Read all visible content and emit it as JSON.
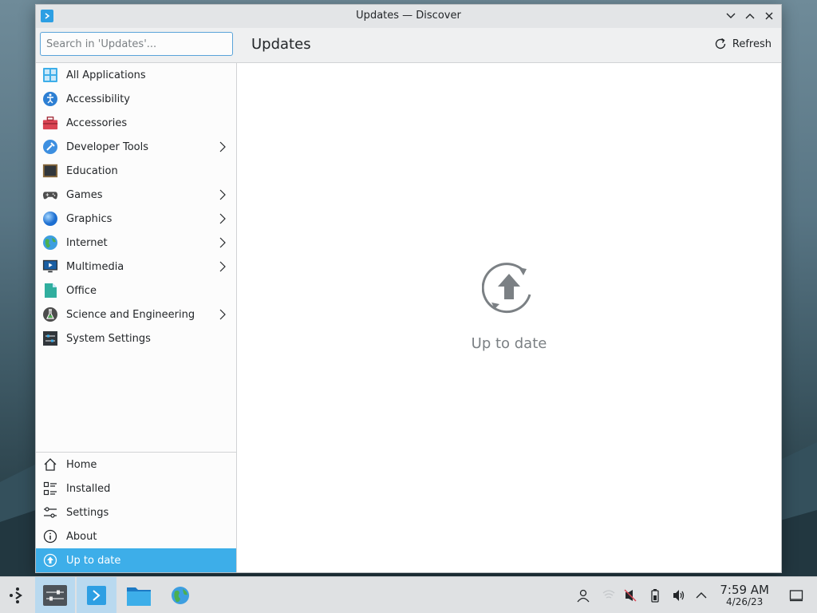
{
  "window": {
    "title": "Updates — Discover"
  },
  "search": {
    "placeholder": "Search in 'Updates'..."
  },
  "header": {
    "page_title": "Updates",
    "refresh_label": "Refresh"
  },
  "categories": [
    {
      "label": "All Applications",
      "icon": "grid-icon",
      "has_submenu": false
    },
    {
      "label": "Accessibility",
      "icon": "accessibility-icon",
      "has_submenu": false
    },
    {
      "label": "Accessories",
      "icon": "toolbox-icon",
      "has_submenu": false
    },
    {
      "label": "Developer Tools",
      "icon": "hammer-icon",
      "has_submenu": true
    },
    {
      "label": "Education",
      "icon": "chalkboard-icon",
      "has_submenu": false
    },
    {
      "label": "Games",
      "icon": "gamepad-icon",
      "has_submenu": true
    },
    {
      "label": "Graphics",
      "icon": "sphere-icon",
      "has_submenu": true
    },
    {
      "label": "Internet",
      "icon": "globe-icon",
      "has_submenu": true
    },
    {
      "label": "Multimedia",
      "icon": "monitor-play-icon",
      "has_submenu": true
    },
    {
      "label": "Office",
      "icon": "document-icon",
      "has_submenu": false
    },
    {
      "label": "Science and Engineering",
      "icon": "flask-icon",
      "has_submenu": true
    },
    {
      "label": "System Settings",
      "icon": "settings-panel-icon",
      "has_submenu": false
    }
  ],
  "bottom_nav": {
    "home": "Home",
    "installed": "Installed",
    "settings": "Settings",
    "about": "About",
    "up_to_date": "Up to date"
  },
  "main": {
    "status_text": "Up to date"
  },
  "taskbar": {
    "time": "7:59 AM",
    "date": "4/26/23"
  },
  "colors": {
    "accent": "#3daee9",
    "window_bg": "#eff0f1",
    "content_bg": "#ffffff"
  }
}
